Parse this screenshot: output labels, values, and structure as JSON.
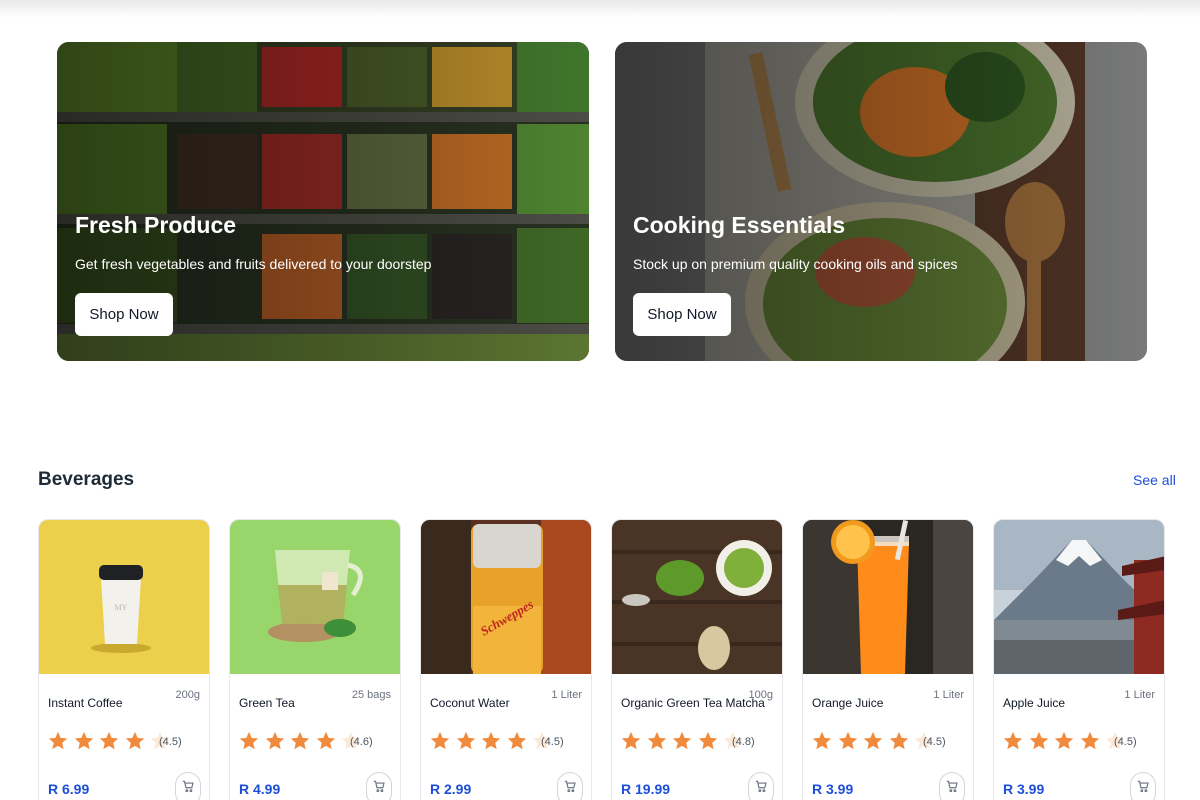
{
  "banners": [
    {
      "title": "Fresh Produce",
      "subtitle": "Get fresh vegetables and fruits delivered to your doorstep",
      "button": "Shop Now"
    },
    {
      "title": "Cooking Essentials",
      "subtitle": "Stock up on premium quality cooking oils and spices",
      "button": "Shop Now"
    }
  ],
  "section": {
    "title": "Beverages",
    "see_all": "See all"
  },
  "products": [
    {
      "name": "Instant Coffee",
      "size": "200g",
      "rating": 4.5,
      "rating_label": "(4.5)",
      "price": "R 6.99"
    },
    {
      "name": "Green Tea",
      "size": "25 bags",
      "rating": 4.6,
      "rating_label": "(4.6)",
      "price": "R 4.99"
    },
    {
      "name": "Coconut Water",
      "size": "1 Liter",
      "rating": 4.5,
      "rating_label": "(4.5)",
      "price": "R 2.99"
    },
    {
      "name": "Organic Green Tea Matcha",
      "size": "100g",
      "rating": 4.8,
      "rating_label": "(4.8)",
      "price": "R 19.99"
    },
    {
      "name": "Orange Juice",
      "size": "1 Liter",
      "rating": 4.5,
      "rating_label": "(4.5)",
      "price": "R 3.99"
    },
    {
      "name": "Apple Juice",
      "size": "1 Liter",
      "rating": 4.5,
      "rating_label": "(4.5)",
      "price": "R 3.99"
    }
  ],
  "colors": {
    "accent": "#1d4ed8",
    "star": "#f08a3c",
    "star_empty": "#fde8d6"
  },
  "icons": {
    "cart": "shopping-cart-icon",
    "star": "star-icon"
  }
}
